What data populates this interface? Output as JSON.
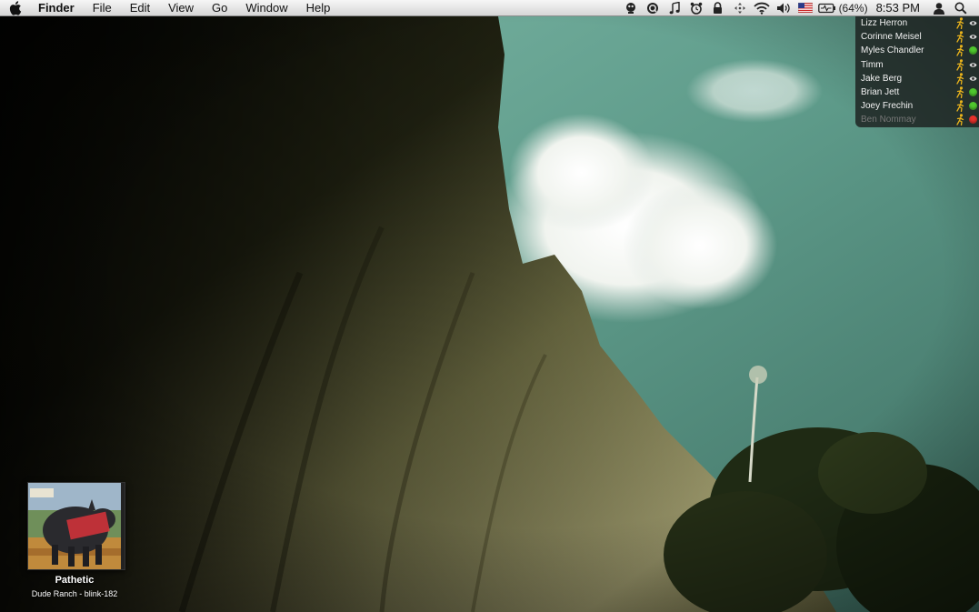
{
  "menubar": {
    "apple_icon": "apple-logo-icon",
    "app_name": "Finder",
    "menus": [
      "File",
      "Edit",
      "View",
      "Go",
      "Window",
      "Help"
    ],
    "status_icons": [
      "adium-duck-icon",
      "quicksilver-icon",
      "itunes-note-icon",
      "alarm-clock-icon",
      "lock-icon",
      "spaces-arrows-icon",
      "wifi-icon",
      "volume-icon",
      "us-flag-input-icon",
      "battery-icon"
    ],
    "battery_percent": "(64%)",
    "clock": "8:53 PM",
    "user_icon": "user-silhouette-icon",
    "spotlight_icon": "spotlight-search-icon"
  },
  "buddies": [
    {
      "name": "Lizz Herron",
      "status": "eye",
      "online": true
    },
    {
      "name": "Corinne Meisel",
      "status": "eye",
      "online": true
    },
    {
      "name": "Myles Chandler",
      "status": "available",
      "online": true
    },
    {
      "name": "Timm",
      "status": "eye",
      "online": true
    },
    {
      "name": "Jake Berg",
      "status": "eye",
      "online": true
    },
    {
      "name": "Brian Jett",
      "status": "available",
      "online": true
    },
    {
      "name": "Joey Frechin",
      "status": "available",
      "online": true
    },
    {
      "name": "Ben Nommay",
      "status": "away",
      "online": false
    }
  ],
  "colors": {
    "available": "#4fc62e",
    "away": "#e8322c",
    "runner": "#e8b21c"
  },
  "now_playing": {
    "title": "Pathetic",
    "subtitle": "Dude Ranch - blink-182"
  }
}
